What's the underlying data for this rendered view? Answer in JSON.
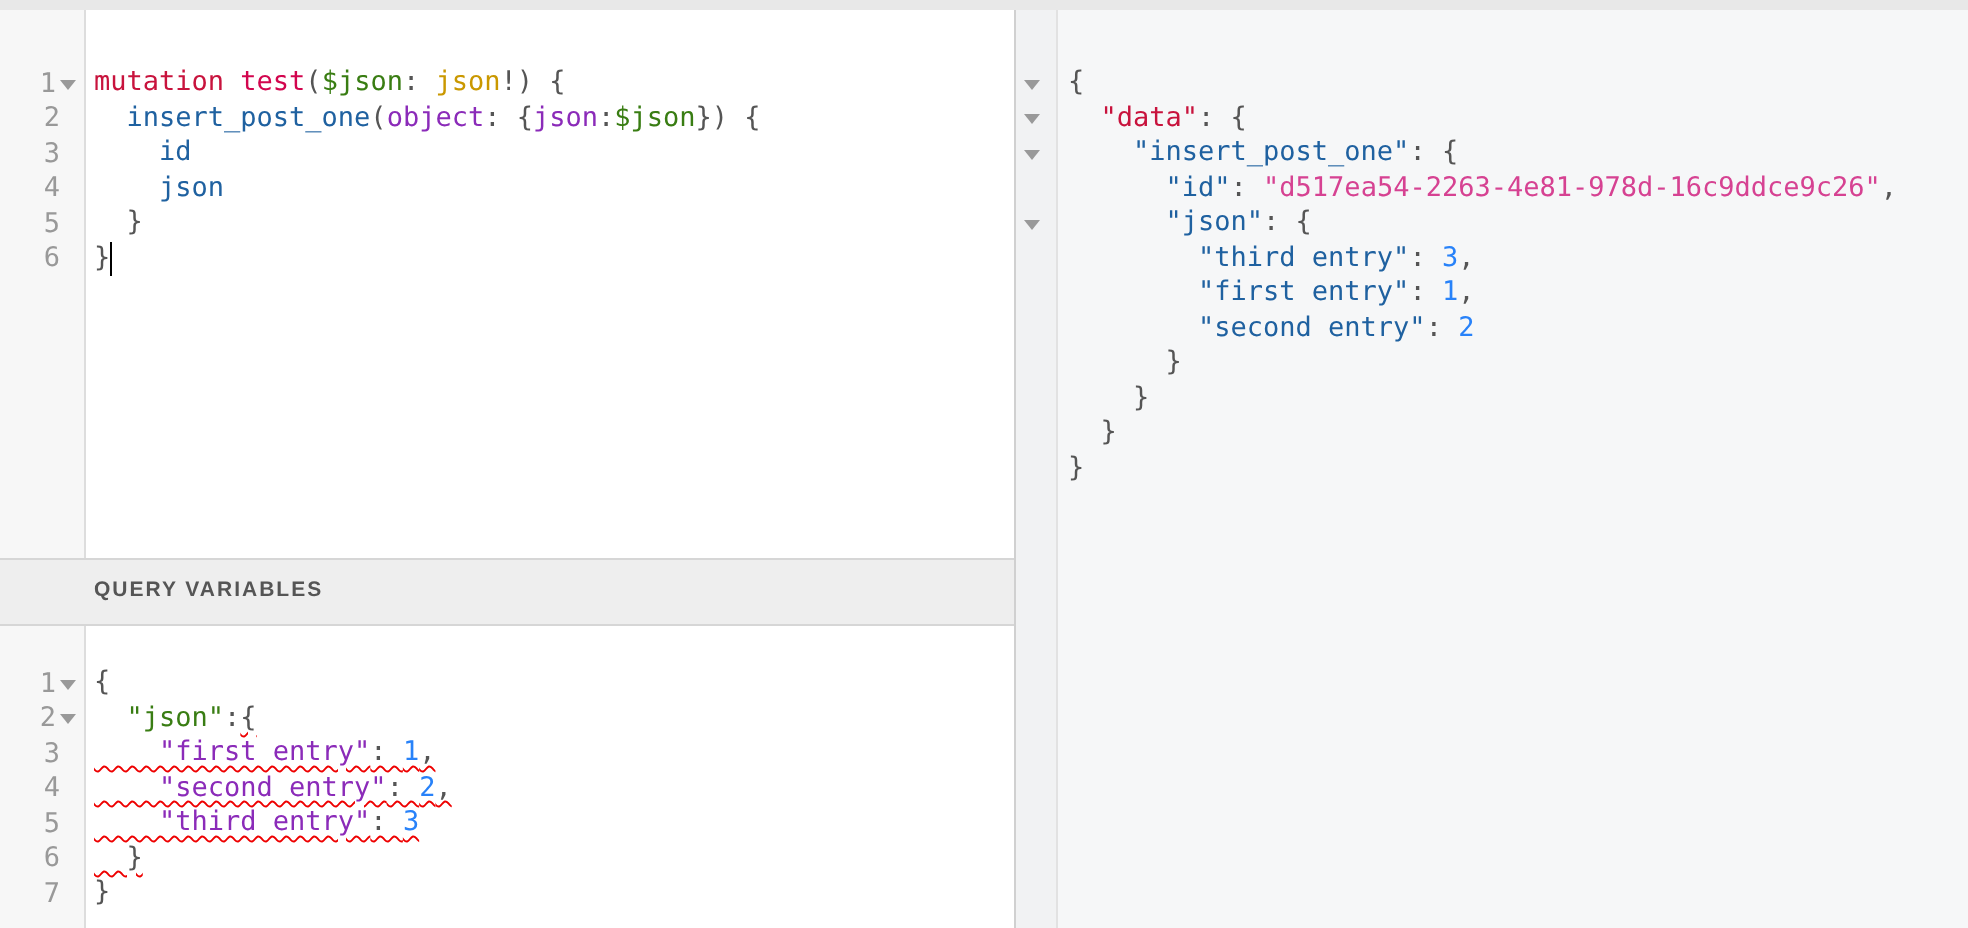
{
  "query_editor": {
    "lines": [
      {
        "number": "1",
        "foldable": true,
        "cursor": false,
        "tokens": [
          {
            "kind": "keyword",
            "text": "mutation "
          },
          {
            "kind": "def",
            "text": "test"
          },
          {
            "kind": "punct",
            "text": "("
          },
          {
            "kind": "variable",
            "text": "$json"
          },
          {
            "kind": "punct",
            "text": ": "
          },
          {
            "kind": "type",
            "text": "json"
          },
          {
            "kind": "punct",
            "text": "!) {"
          }
        ]
      },
      {
        "number": "2",
        "foldable": false,
        "cursor": false,
        "tokens": [
          {
            "kind": "property",
            "text": "  insert_post_one"
          },
          {
            "kind": "punct",
            "text": "("
          },
          {
            "kind": "attribute",
            "text": "object"
          },
          {
            "kind": "punct",
            "text": ": {"
          },
          {
            "kind": "attribute",
            "text": "json"
          },
          {
            "kind": "punct",
            "text": ":"
          },
          {
            "kind": "variable",
            "text": "$json"
          },
          {
            "kind": "punct",
            "text": "}) {"
          }
        ]
      },
      {
        "number": "3",
        "foldable": false,
        "cursor": false,
        "tokens": [
          {
            "kind": "property",
            "text": "    id"
          }
        ]
      },
      {
        "number": "4",
        "foldable": false,
        "cursor": false,
        "tokens": [
          {
            "kind": "property",
            "text": "    json"
          }
        ]
      },
      {
        "number": "5",
        "foldable": false,
        "cursor": false,
        "tokens": [
          {
            "kind": "punct",
            "text": "  }"
          }
        ]
      },
      {
        "number": "6",
        "foldable": false,
        "cursor": true,
        "tokens": [
          {
            "kind": "punct",
            "text": "}"
          }
        ]
      }
    ]
  },
  "variables_panel": {
    "title": "QUERY VARIABLES",
    "lines": [
      {
        "number": "1",
        "foldable": true,
        "tokens": [
          {
            "kind": "punct",
            "text": "{",
            "error": false
          }
        ]
      },
      {
        "number": "2",
        "foldable": true,
        "tokens": [
          {
            "kind": "variable",
            "text": "  \"json\"",
            "error": false
          },
          {
            "kind": "punct",
            "text": ":",
            "error": false
          },
          {
            "kind": "punct",
            "text": "{",
            "error": true
          }
        ]
      },
      {
        "number": "3",
        "foldable": false,
        "tokens": [
          {
            "kind": "attribute",
            "text": "    \"first entry\"",
            "error": true
          },
          {
            "kind": "punct",
            "text": ": ",
            "error": true
          },
          {
            "kind": "number",
            "text": "1",
            "error": true
          },
          {
            "kind": "punct",
            "text": ",",
            "error": true
          }
        ]
      },
      {
        "number": "4",
        "foldable": false,
        "tokens": [
          {
            "kind": "attribute",
            "text": "    \"second entry\"",
            "error": true
          },
          {
            "kind": "punct",
            "text": ": ",
            "error": true
          },
          {
            "kind": "number",
            "text": "2",
            "error": true
          },
          {
            "kind": "punct",
            "text": ",",
            "error": true
          }
        ]
      },
      {
        "number": "5",
        "foldable": false,
        "tokens": [
          {
            "kind": "attribute",
            "text": "    \"third entry\"",
            "error": true
          },
          {
            "kind": "punct",
            "text": ": ",
            "error": true
          },
          {
            "kind": "number",
            "text": "3",
            "error": true
          }
        ]
      },
      {
        "number": "6",
        "foldable": false,
        "tokens": [
          {
            "kind": "punct",
            "text": "  }",
            "error": true
          }
        ]
      },
      {
        "number": "7",
        "foldable": false,
        "tokens": [
          {
            "kind": "punct",
            "text": "}",
            "error": false
          }
        ]
      }
    ]
  },
  "result_viewer": {
    "lines": [
      {
        "foldable": true,
        "tokens": [
          {
            "kind": "punct",
            "text": "{"
          }
        ]
      },
      {
        "foldable": true,
        "tokens": [
          {
            "kind": "keyword",
            "text": "  \"data\""
          },
          {
            "kind": "punct",
            "text": ": {"
          }
        ]
      },
      {
        "foldable": true,
        "tokens": [
          {
            "kind": "property",
            "text": "    \"insert_post_one\""
          },
          {
            "kind": "punct",
            "text": ": {"
          }
        ]
      },
      {
        "foldable": false,
        "tokens": [
          {
            "kind": "property",
            "text": "      \"id\""
          },
          {
            "kind": "punct",
            "text": ": "
          },
          {
            "kind": "string",
            "text": "\"d517ea54-2263-4e81-978d-16c9ddce9c26\""
          },
          {
            "kind": "punct",
            "text": ","
          }
        ]
      },
      {
        "foldable": true,
        "tokens": [
          {
            "kind": "property",
            "text": "      \"json\""
          },
          {
            "kind": "punct",
            "text": ": {"
          }
        ]
      },
      {
        "foldable": false,
        "tokens": [
          {
            "kind": "property",
            "text": "        \"third entry\""
          },
          {
            "kind": "punct",
            "text": ": "
          },
          {
            "kind": "number",
            "text": "3"
          },
          {
            "kind": "punct",
            "text": ","
          }
        ]
      },
      {
        "foldable": false,
        "tokens": [
          {
            "kind": "property",
            "text": "        \"first entry\""
          },
          {
            "kind": "punct",
            "text": ": "
          },
          {
            "kind": "number",
            "text": "1"
          },
          {
            "kind": "punct",
            "text": ","
          }
        ]
      },
      {
        "foldable": false,
        "tokens": [
          {
            "kind": "property",
            "text": "        \"second entry\""
          },
          {
            "kind": "punct",
            "text": ": "
          },
          {
            "kind": "number",
            "text": "2"
          }
        ]
      },
      {
        "foldable": false,
        "tokens": [
          {
            "kind": "punct",
            "text": "      }"
          }
        ]
      },
      {
        "foldable": false,
        "tokens": [
          {
            "kind": "punct",
            "text": "    }"
          }
        ]
      },
      {
        "foldable": false,
        "tokens": [
          {
            "kind": "punct",
            "text": "  }"
          }
        ]
      },
      {
        "foldable": false,
        "tokens": [
          {
            "kind": "punct",
            "text": "}"
          }
        ]
      }
    ]
  }
}
